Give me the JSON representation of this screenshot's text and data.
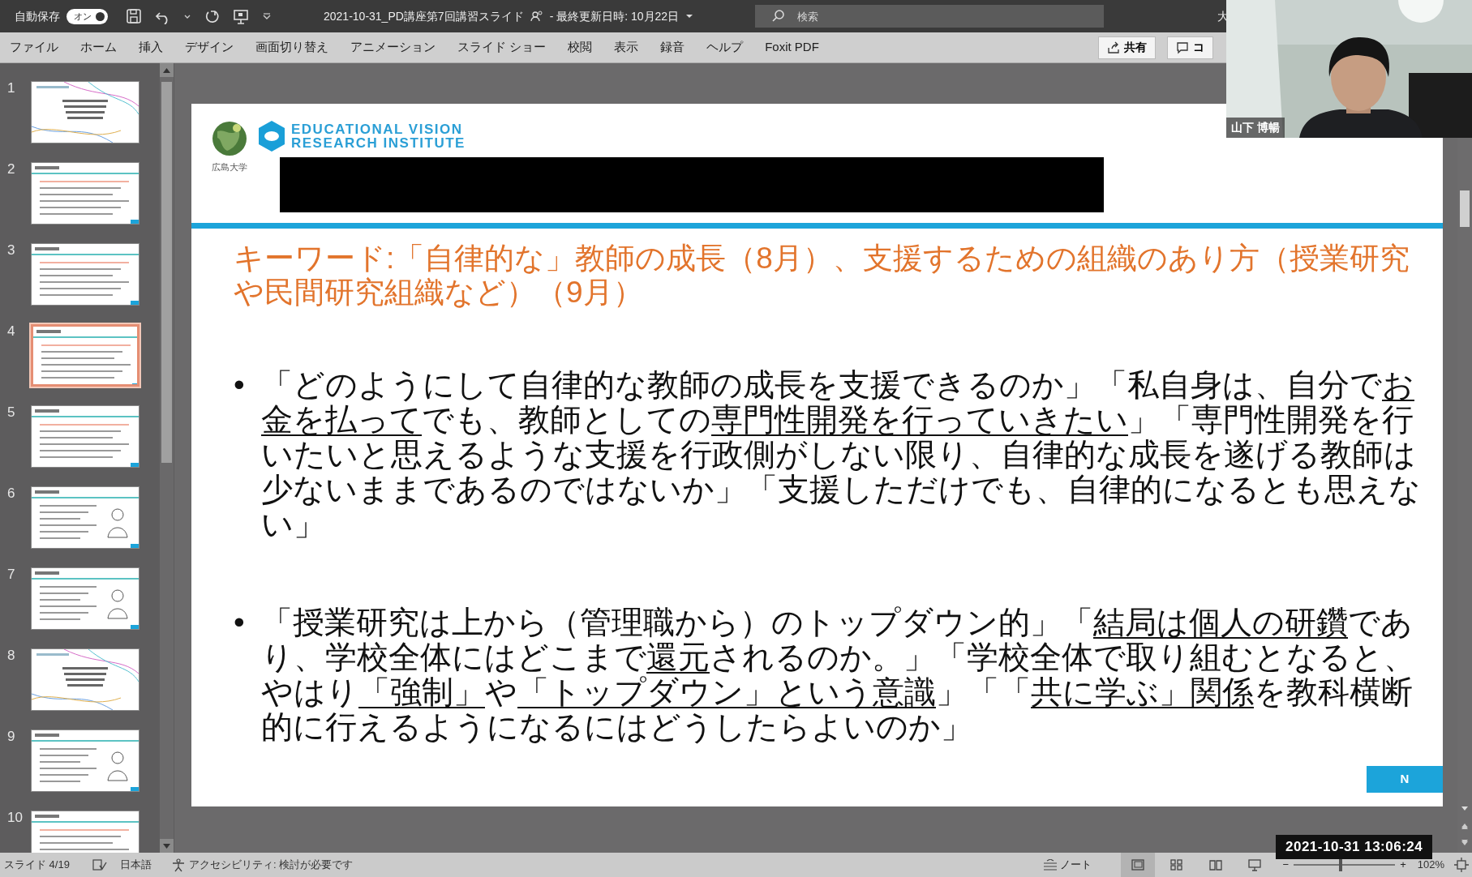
{
  "title_bar": {
    "autosave_label": "自動保存",
    "autosave_toggle": {
      "label": "オン",
      "on": true
    },
    "document_title": "2021-10-31_PD講座第7回講習スライド",
    "last_modified": "- 最終更新日時: 10月22日",
    "search": {
      "placeholder": "検索"
    },
    "user_name": "大"
  },
  "ribbon_tabs": [
    {
      "label": "ファイル"
    },
    {
      "label": "ホーム"
    },
    {
      "label": "挿入"
    },
    {
      "label": "デザイン"
    },
    {
      "label": "画面切り替え"
    },
    {
      "label": "アニメーション"
    },
    {
      "label": "スライド ショー"
    },
    {
      "label": "校閲"
    },
    {
      "label": "表示"
    },
    {
      "label": "録音"
    },
    {
      "label": "ヘルプ"
    },
    {
      "label": "Foxit PDF"
    }
  ],
  "ribbon_buttons": [
    {
      "label": "共有",
      "kind": "share"
    },
    {
      "label": "コ",
      "kind": "comment"
    }
  ],
  "thumbnails": [
    {
      "number": "1",
      "kind": "title",
      "selected": false
    },
    {
      "number": "2",
      "kind": "text",
      "selected": false
    },
    {
      "number": "3",
      "kind": "text",
      "selected": false
    },
    {
      "number": "4",
      "kind": "text",
      "selected": true
    },
    {
      "number": "5",
      "kind": "text",
      "selected": false
    },
    {
      "number": "6",
      "kind": "illustrated",
      "selected": false
    },
    {
      "number": "7",
      "kind": "illustrated",
      "selected": false
    },
    {
      "number": "8",
      "kind": "title",
      "selected": false
    },
    {
      "number": "9",
      "kind": "illustrated",
      "selected": false
    },
    {
      "number": "10",
      "kind": "text",
      "selected": false
    }
  ],
  "slide": {
    "logo_caption": "広島大学",
    "logo_line_1": "EDUCATIONAL VISION",
    "logo_line_2": "RESEARCH INSTITUTE",
    "title": "キーワード:「自律的な」教師の成長（8月）、支援するための組織のあり方（授業研究や民間研究組織など）（9月）",
    "bullets": [
      {
        "marker": "•",
        "segments": [
          {
            "text": "「どのようにして自律的な教師の成長を支援できるのか」「私自身は、自分で",
            "underlined": false
          },
          {
            "text": "お金を払って",
            "underlined": true
          },
          {
            "text": "でも、教師としての",
            "underlined": false
          },
          {
            "text": "専門性開発を行っていきたい",
            "underlined": true
          },
          {
            "text": "」「専門性開発を行いたいと思えるような支援を行政側がしない限り、自律的な成長を遂げる教師は少ないままであるのではないか」「支援しただけでも、自律的になるとも思えない」",
            "underlined": false
          }
        ]
      },
      {
        "marker": "•",
        "segments": [
          {
            "text": "「授業研究は上から（管理職から）のトップダウン的」「",
            "underlined": false
          },
          {
            "text": "結局は個人の研鑽",
            "underlined": true
          },
          {
            "text": "であり、学校全体にはどこまで",
            "underlined": false
          },
          {
            "text": "還元",
            "underlined": true
          },
          {
            "text": "されるのか。」「学校全体で取り組むとなると、やはり",
            "underlined": false
          },
          {
            "text": "「強制」",
            "underlined": true
          },
          {
            "text": "や",
            "underlined": false
          },
          {
            "text": "「トップダウン」という意識",
            "underlined": true
          },
          {
            "text": "」「「",
            "underlined": false
          },
          {
            "text": "共に学ぶ」関係",
            "underlined": true
          },
          {
            "text": "を教科横断的に行えるようになるにはどうしたらよいのか」",
            "underlined": false
          }
        ]
      }
    ],
    "page_number": "N"
  },
  "video": {
    "name": "山下 博暢"
  },
  "timestamp": "2021-10-31 13:06:24",
  "status_bar": {
    "slide_info": "スライド 4/19",
    "language": "日本語",
    "accessibility": "アクセシビリティ: 検討が必要です",
    "notes": "ノート",
    "views": [
      {
        "kind": "normal",
        "selected": true
      },
      {
        "kind": "sorter",
        "selected": false
      },
      {
        "kind": "reading",
        "selected": false
      },
      {
        "kind": "slideshow",
        "selected": false
      }
    ],
    "zoom_minus": "−",
    "zoom_plus": "+",
    "zoom": {
      "level": 0.46
    },
    "zoom_percent": "102%"
  }
}
